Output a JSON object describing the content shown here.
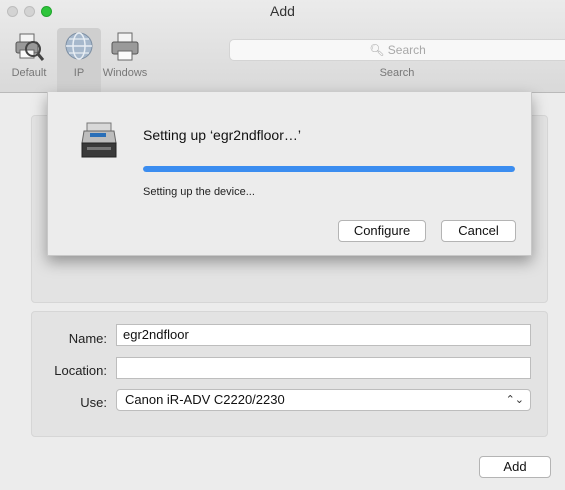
{
  "window": {
    "title": "Add"
  },
  "toolbar": {
    "items": [
      {
        "label": "Default",
        "icon": "printer-magnifier-icon"
      },
      {
        "label": "IP",
        "icon": "globe-icon"
      },
      {
        "label": "Windows",
        "icon": "printer-icon"
      }
    ],
    "search": {
      "placeholder": "Search",
      "label": "Search"
    }
  },
  "sheet": {
    "title": "Setting up ‘egr2ndfloor…’",
    "status": "Setting up the device...",
    "progress": 1.0,
    "configure_label": "Configure",
    "cancel_label": "Cancel",
    "accent": "#3b8df0"
  },
  "form": {
    "name_label": "Name:",
    "name_value": "egr2ndfloor",
    "location_label": "Location:",
    "location_value": "",
    "use_label": "Use:",
    "use_value": "Canon iR-ADV C2220/2230"
  },
  "footer": {
    "add_label": "Add"
  }
}
